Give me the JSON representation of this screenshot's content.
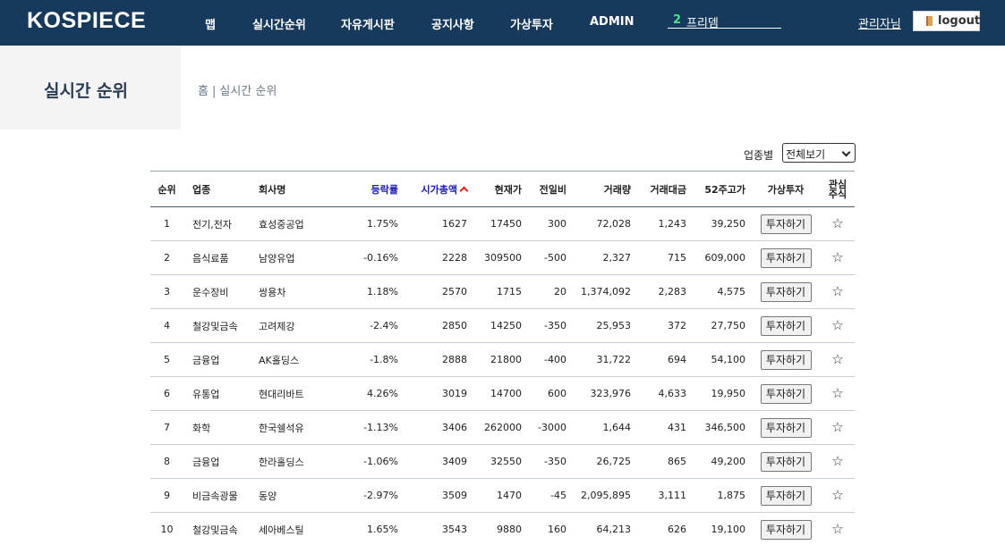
{
  "header": {
    "logo": "KOSPIECE",
    "nav": [
      "맵",
      "실시간순위",
      "자유게시판",
      "공지사항",
      "가상투자",
      "ADMIN"
    ],
    "search": {
      "count": "2",
      "text": "프리뎀"
    },
    "admin_link": "관리자님",
    "logout_label": "logout"
  },
  "page": {
    "title": "실시간 순위",
    "breadcrumb": [
      "홈",
      "|",
      "실시간 순위"
    ]
  },
  "filter": {
    "label": "업종별",
    "selected": "전체보기"
  },
  "table": {
    "columns": {
      "rank": "순위",
      "sector": "업종",
      "name": "회사명",
      "rate": "등락률",
      "cap": "시가총액",
      "price": "현재가",
      "diff": "전일비",
      "vol": "거래량",
      "amount": "거래대금",
      "high52": "52주고가",
      "invest": "가상투자",
      "fav_line1": "관심",
      "fav_line2": "주식"
    },
    "invest_label": "투자하기",
    "rows": [
      {
        "rank": "1",
        "sector": "전기,전자",
        "name": "효성중공업",
        "rate": "1.75%",
        "cap": "1627",
        "price": "17450",
        "diff": "300",
        "vol": "72,028",
        "amount": "1,243",
        "high52": "39,250"
      },
      {
        "rank": "2",
        "sector": "음식료품",
        "name": "남양유업",
        "rate": "-0.16%",
        "cap": "2228",
        "price": "309500",
        "diff": "-500",
        "vol": "2,327",
        "amount": "715",
        "high52": "609,000"
      },
      {
        "rank": "3",
        "sector": "운수장비",
        "name": "쌍용차",
        "rate": "1.18%",
        "cap": "2570",
        "price": "1715",
        "diff": "20",
        "vol": "1,374,092",
        "amount": "2,283",
        "high52": "4,575"
      },
      {
        "rank": "4",
        "sector": "철강및금속",
        "name": "고려제강",
        "rate": "-2.4%",
        "cap": "2850",
        "price": "14250",
        "diff": "-350",
        "vol": "25,953",
        "amount": "372",
        "high52": "27,750"
      },
      {
        "rank": "5",
        "sector": "금융업",
        "name": "AK홀딩스",
        "rate": "-1.8%",
        "cap": "2888",
        "price": "21800",
        "diff": "-400",
        "vol": "31,722",
        "amount": "694",
        "high52": "54,100"
      },
      {
        "rank": "6",
        "sector": "유통업",
        "name": "현대리바트",
        "rate": "4.26%",
        "cap": "3019",
        "price": "14700",
        "diff": "600",
        "vol": "323,976",
        "amount": "4,633",
        "high52": "19,950"
      },
      {
        "rank": "7",
        "sector": "화학",
        "name": "한국쉘석유",
        "rate": "-1.13%",
        "cap": "3406",
        "price": "262000",
        "diff": "-3000",
        "vol": "1,644",
        "amount": "431",
        "high52": "346,500"
      },
      {
        "rank": "8",
        "sector": "금융업",
        "name": "한라홀딩스",
        "rate": "-1.06%",
        "cap": "3409",
        "price": "32550",
        "diff": "-350",
        "vol": "26,725",
        "amount": "865",
        "high52": "49,200"
      },
      {
        "rank": "9",
        "sector": "비금속광물",
        "name": "동양",
        "rate": "-2.97%",
        "cap": "3509",
        "price": "1470",
        "diff": "-45",
        "vol": "2,095,895",
        "amount": "3,111",
        "high52": "1,875"
      },
      {
        "rank": "10",
        "sector": "철강및금속",
        "name": "세아베스틸",
        "rate": "1.65%",
        "cap": "3543",
        "price": "9880",
        "diff": "160",
        "vol": "64,213",
        "amount": "626",
        "high52": "19,100"
      }
    ]
  },
  "colors": {
    "header_bg": "#17395c",
    "accent_blue": "#1a1ab8",
    "sort_arrow": "#e02020",
    "search_count": "#4ee08a"
  },
  "icons": {
    "sort": "chevron-up-icon",
    "favorite": "star-outline-icon",
    "logout": "door-icon",
    "select": "chevron-down-icon"
  }
}
